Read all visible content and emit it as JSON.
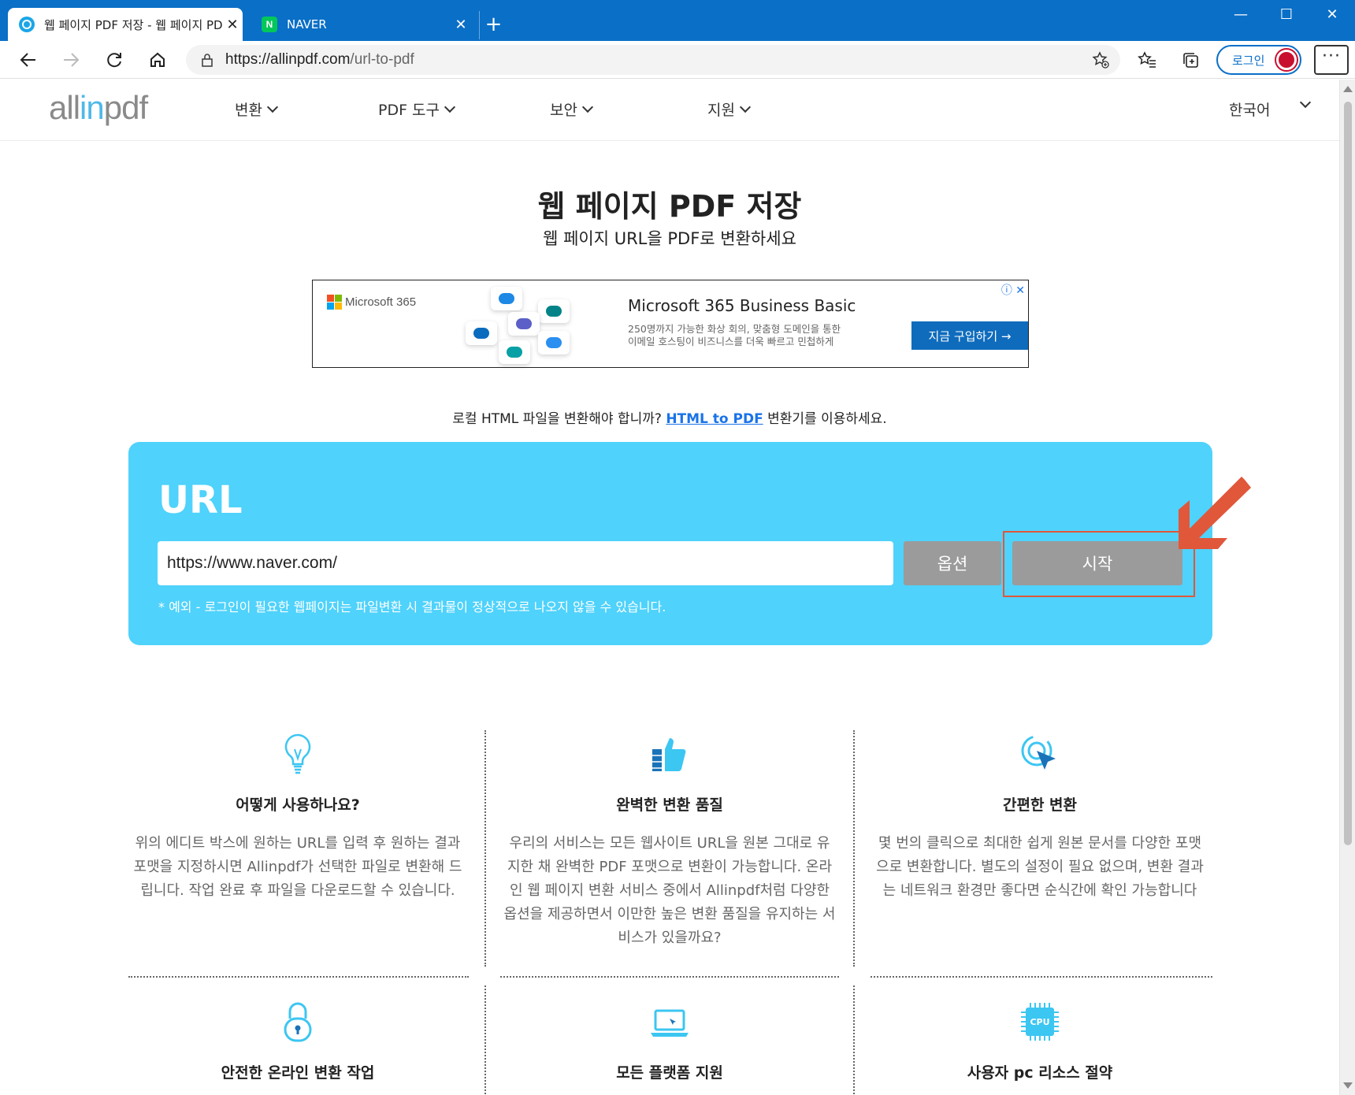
{
  "browser": {
    "tabs": [
      {
        "label": "웹 페이지 PDF 저장 - 웹 페이지 PDF",
        "active": true
      },
      {
        "label": "NAVER",
        "active": false
      }
    ],
    "naver_favicon": "N",
    "address": {
      "host": "https://allinpdf.com",
      "path": "/url-to-pdf"
    },
    "login_label": "로그인",
    "menu_label": "···"
  },
  "site": {
    "logo": {
      "part1": "all",
      "part2": "in",
      "part3": "pdf"
    },
    "nav": [
      "변환",
      "PDF 도구",
      "보안",
      "지원"
    ],
    "language": "한국어"
  },
  "hero": {
    "title": "웹 페이지 PDF 저장",
    "subtitle": "웹 페이지 URL을 PDF로 변환하세요"
  },
  "ad": {
    "brand": "Microsoft 365",
    "title": "Microsoft 365 Business Basic",
    "desc_line1": "250명까지 가능한 화상 회의, 맞춤형 도메인을 통한",
    "desc_line2": "이메일 호스팅이 비즈니스를 더욱 빠르고 민첩하게",
    "cta": "지금 구입하기 →",
    "icons": "ⓘ ✕"
  },
  "notice": {
    "before": "로컬 HTML 파일을 변환해야 합니까? ",
    "link": "HTML to PDF",
    "after": " 변환기를 이용하세요."
  },
  "converter": {
    "label": "URL",
    "url_value": "https://www.naver.com/",
    "options_button": "옵션",
    "start_button": "시작",
    "hint": "* 예외 - 로그인이 필요한 웹페이지는 파일변환 시 결과물이 정상적으로 나오지 않을 수 있습니다."
  },
  "features": [
    {
      "icon": "lightbulb-icon",
      "title": "어떻게 사용하나요?",
      "desc": "위의 에디트 박스에 원하는 URL를 입력 후 원하는 결과 포맷을 지정하시면 Allinpdf가 선택한 파일로 변환해 드립니다. 작업 완료 후 파일을 다운로드할 수 있습니다."
    },
    {
      "icon": "thumbs-up-icon",
      "title": "완벽한 변환 품질",
      "desc": "우리의 서비스는 모든 웹사이트 URL을 원본 그대로 유지한 채 완벽한 PDF 포맷으로 변환이 가능합니다. 온라인 웹 페이지 변환 서비스 중에서 Allinpdf처럼 다양한 옵션을 제공하면서 이만한 높은 변환 품질을 유지하는 서비스가 있을까요?"
    },
    {
      "icon": "click-pointer-icon",
      "title": "간편한 변환",
      "desc": "몇 번의 클릭으로 최대한 쉽게 원본 문서를 다양한 포맷으로 변환합니다. 별도의 설정이 필요 없으며, 변환 결과는 네트워크 환경만 좋다면 순식간에 확인 가능합니다"
    },
    {
      "icon": "padlock-icon",
      "title": "안전한 온라인 변환 작업",
      "desc": ""
    },
    {
      "icon": "laptop-icon",
      "title": "모든 플랫폼 지원",
      "desc": ""
    },
    {
      "icon": "cpu-icon",
      "title": "사용자 pc 리소스 절약",
      "desc": "",
      "chip_label": "CPU"
    }
  ],
  "colors": {
    "accent": "#4fd2fb",
    "browser": "#0a6fc7",
    "highlight": "#e0573a",
    "button": "#9b9b9b"
  }
}
